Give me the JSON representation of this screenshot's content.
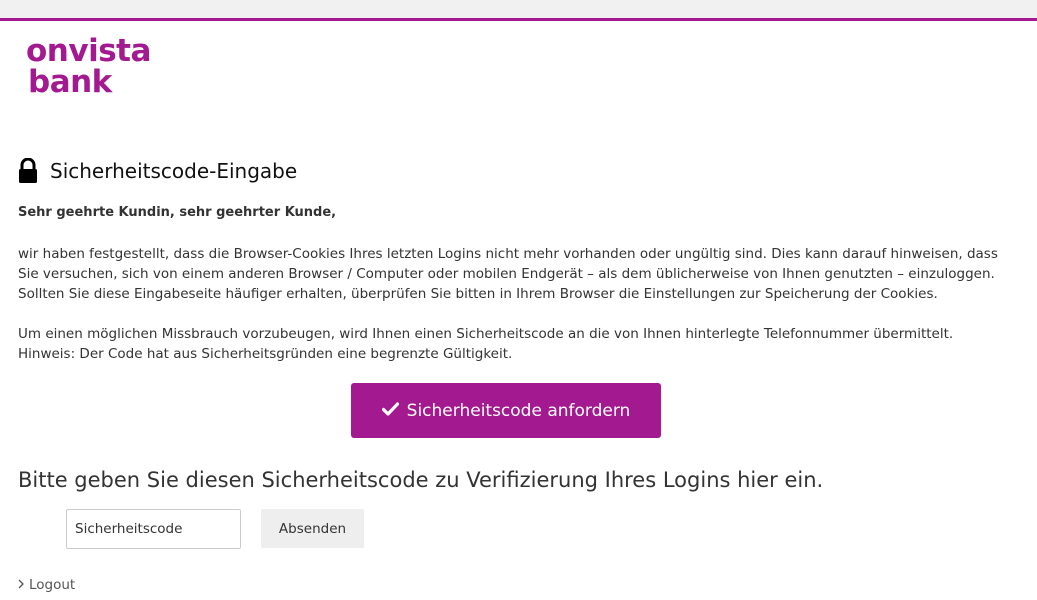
{
  "brand": {
    "logo_line1": "onvista",
    "logo_line2": "bank",
    "color": "#a3198f"
  },
  "heading": {
    "icon": "lock-icon",
    "title": "Sicherheitscode-Eingabe"
  },
  "content": {
    "greeting": "Sehr geehrte Kundin, sehr geehrter Kunde,",
    "paragraph1": "wir haben festgestellt, dass die Browser-Cookies Ihres letzten Logins nicht mehr vorhanden oder ungültig sind. Dies kann darauf hinweisen, dass Sie versuchen, sich von einem anderen Browser / Computer oder mobilen Endgerät – als dem üblicherweise von Ihnen genutzten – einzuloggen. Sollten Sie diese Eingabeseite häufiger erhalten, überprüfen Sie bitten in Ihrem Browser die Einstellungen zur Speicherung der Cookies.",
    "paragraph2": "Um einen möglichen Missbrauch vorzubeugen, wird Ihnen einen Sicherheitscode an die von Ihnen hinterlegte Telefonnummer übermittelt. Hinweis: Der Code hat aus Sicherheitsgründen eine begrenzte Gültigkeit."
  },
  "request_button": {
    "icon": "check-icon",
    "label": "Sicherheitscode anfordern"
  },
  "verification": {
    "prompt": "Bitte geben Sie diesen Sicherheitscode zu Verifizierung Ihres Logins hier ein.",
    "input_placeholder": "Sicherheitscode",
    "input_value": "",
    "submit_label": "Absenden"
  },
  "footer": {
    "logout_label": "Logout",
    "logout_icon": "chevron-right-icon"
  }
}
